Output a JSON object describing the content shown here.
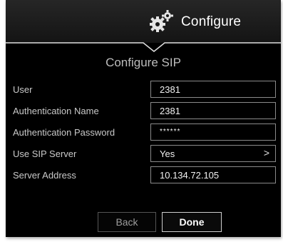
{
  "header": {
    "title": "Configure",
    "icon": "gears-icon"
  },
  "section_title": "Configure SIP",
  "rows": [
    {
      "label": "User",
      "value": "2381"
    },
    {
      "label": "Authentication Name",
      "value": "2381"
    },
    {
      "label": "Authentication Password",
      "value": "******"
    },
    {
      "label": "Use SIP Server",
      "value": "Yes",
      "chevron": ">"
    },
    {
      "label": "Server Address",
      "value": "10.134.72.105"
    }
  ],
  "buttons": {
    "back": "Back",
    "done": "Done"
  }
}
